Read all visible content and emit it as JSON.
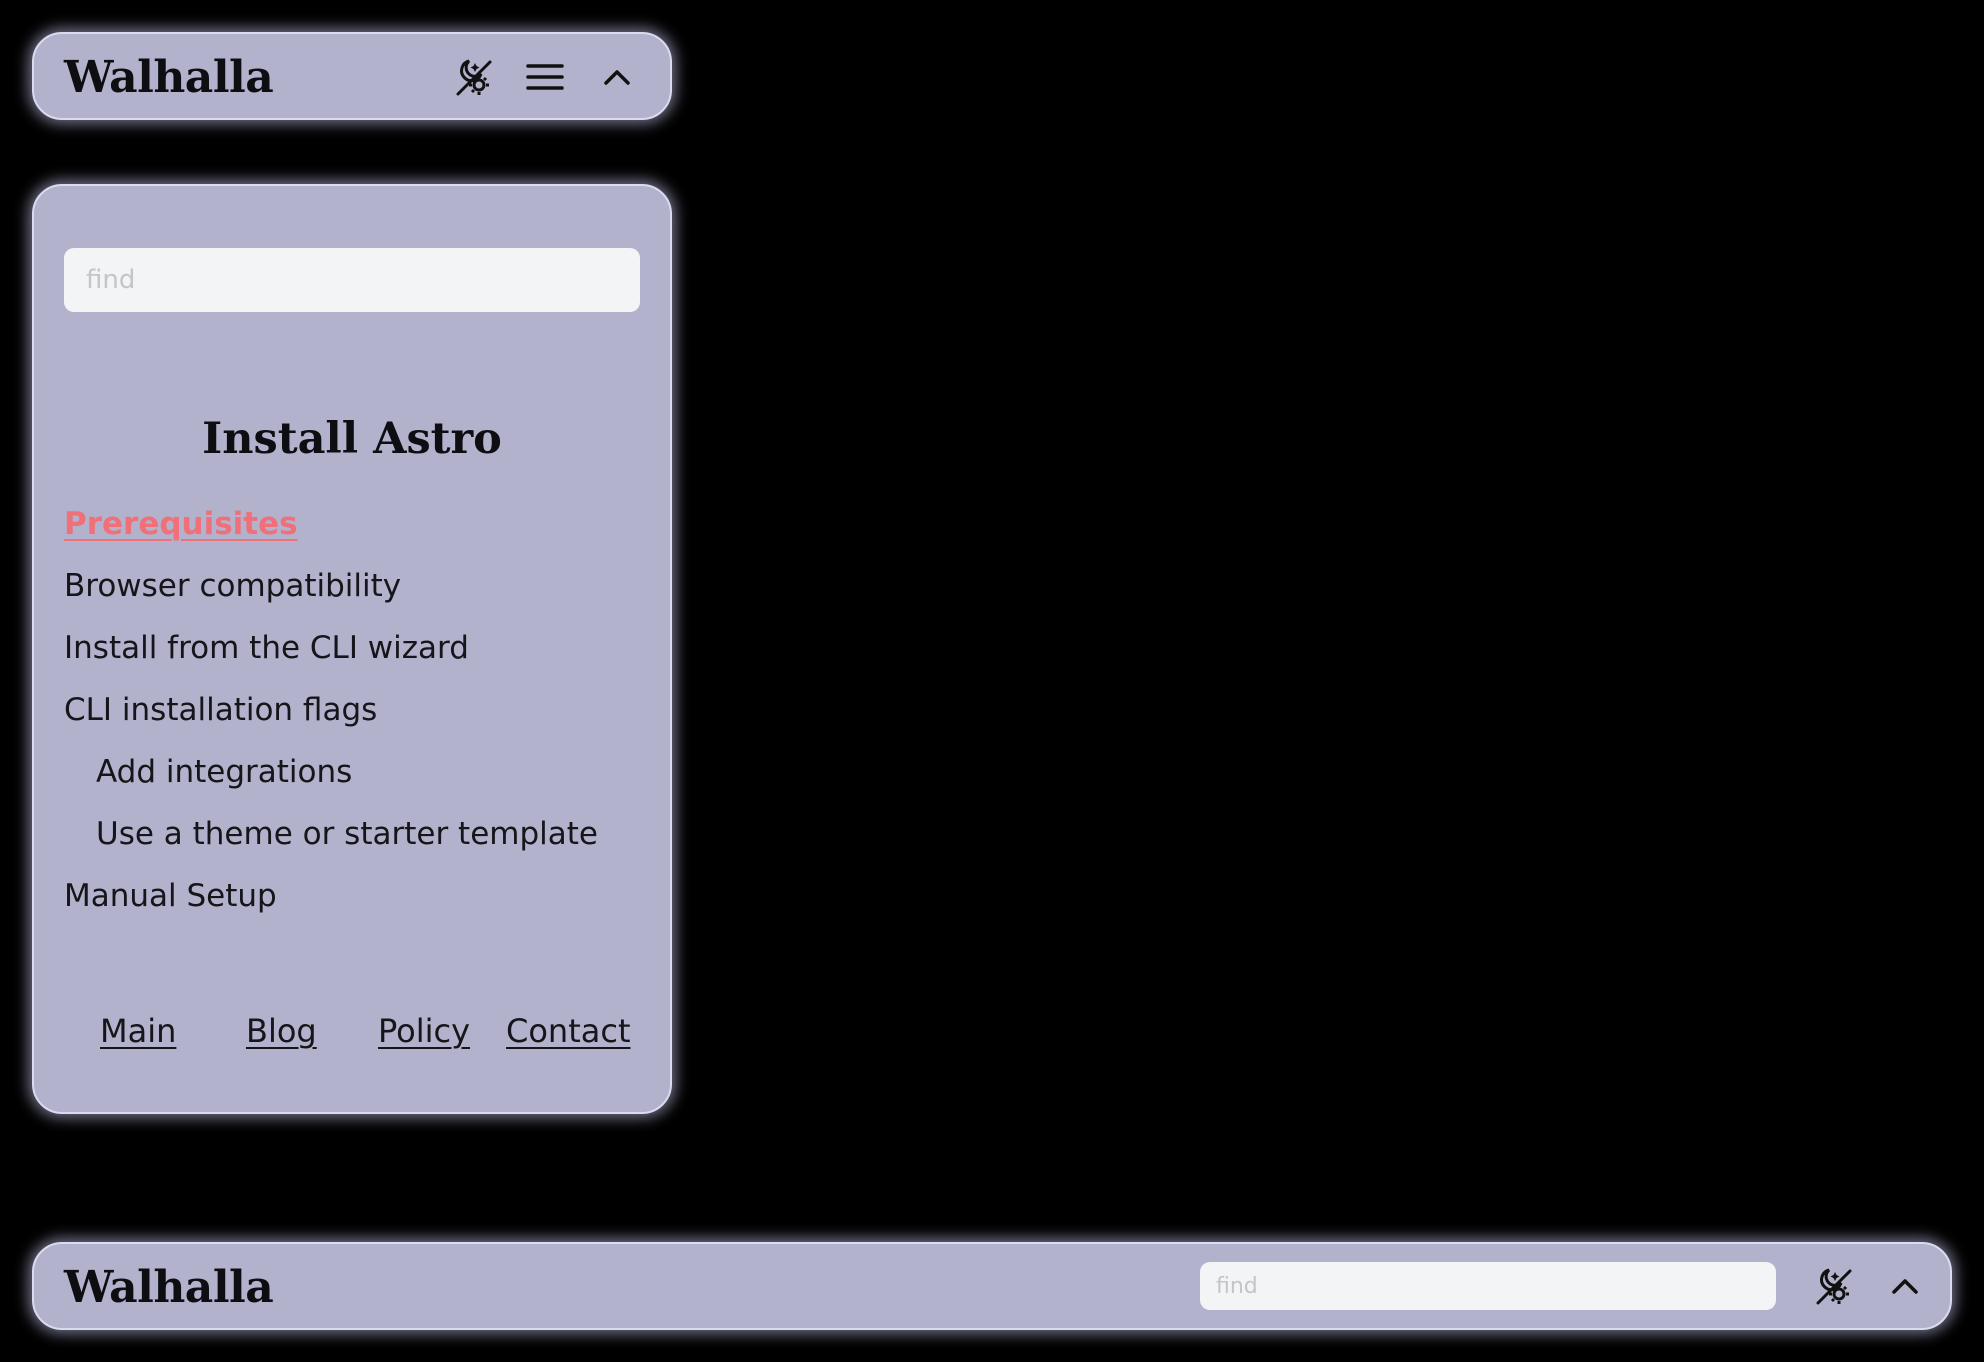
{
  "top_header": {
    "brand": "Walhalla",
    "icons": [
      "theme-toggle-icon",
      "menu-icon",
      "chevron-up-icon"
    ]
  },
  "side_panel": {
    "search": {
      "value": "",
      "placeholder": "find"
    },
    "toc": {
      "title": "Install Astro",
      "items": [
        {
          "label": "Prerequisites",
          "active": true,
          "level": 1
        },
        {
          "label": "Browser compatibility",
          "active": false,
          "level": 1
        },
        {
          "label": "Install from the CLI wizard",
          "active": false,
          "level": 1
        },
        {
          "label": "CLI installation flags",
          "active": false,
          "level": 1
        },
        {
          "label": "Add integrations",
          "active": false,
          "level": 2
        },
        {
          "label": "Use a theme or starter template",
          "active": false,
          "level": 2
        },
        {
          "label": "Manual Setup",
          "active": false,
          "level": 1
        }
      ]
    },
    "footer_links": [
      "Main",
      "Blog",
      "Policy",
      "Contact"
    ]
  },
  "bottom_header": {
    "brand": "Walhalla",
    "search": {
      "value": "",
      "placeholder": "find"
    },
    "icons": [
      "theme-toggle-icon",
      "chevron-up-icon"
    ]
  },
  "colors": {
    "background": "#000000",
    "panel": "#b2b2cc",
    "panel_border": "#dadaf0",
    "text": "#15151a",
    "active_link": "#f0707a",
    "search_bg": "#f2f4f5"
  }
}
